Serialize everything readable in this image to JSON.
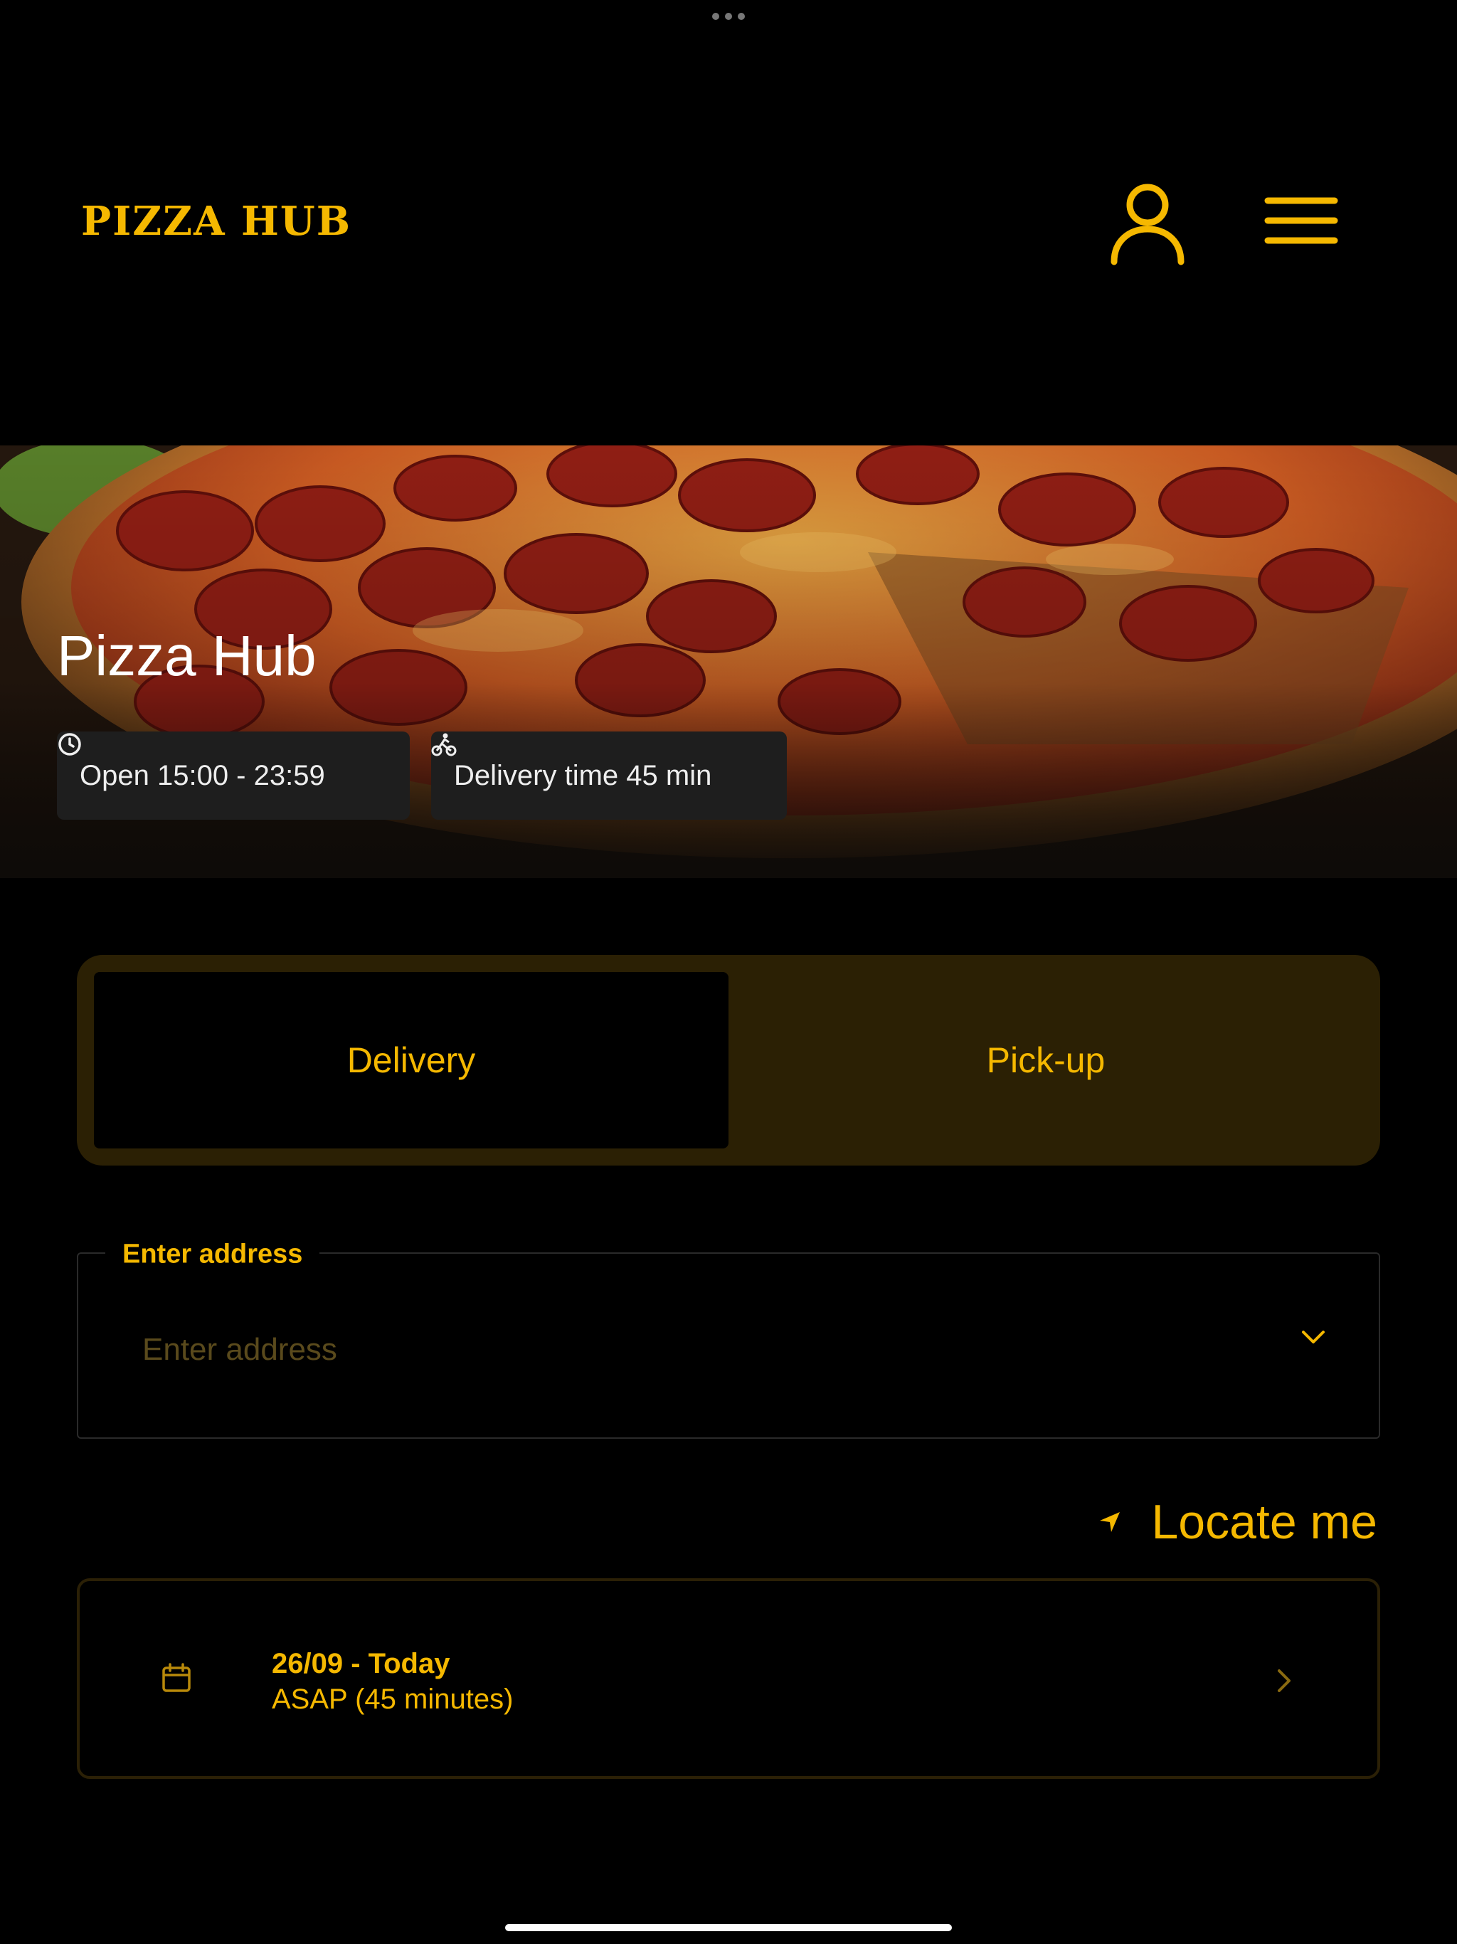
{
  "header": {
    "logo_text": "PIZZA HUB",
    "user_icon": "user-icon",
    "menu_icon": "hamburger-menu-icon"
  },
  "hero": {
    "title": "Pizza Hub",
    "open_hours": "Open 15:00 - 23:59",
    "open_icon": "clock-icon",
    "delivery_time": "Delivery time 45 min",
    "delivery_icon": "bicycle-icon"
  },
  "order_mode": {
    "options": [
      "Delivery",
      "Pick-up"
    ],
    "selected": "Delivery"
  },
  "address": {
    "label": "Enter address",
    "placeholder": "Enter address",
    "value": ""
  },
  "locate": {
    "label": "Locate me",
    "icon": "location-arrow-icon"
  },
  "schedule": {
    "date": "26/09 - Today",
    "time": "ASAP (45 minutes)",
    "icon": "calendar-icon"
  },
  "colors": {
    "accent": "#f5b800",
    "background": "#000000",
    "segment_background": "#2b2004",
    "chip_background": "#1e1e1e"
  }
}
